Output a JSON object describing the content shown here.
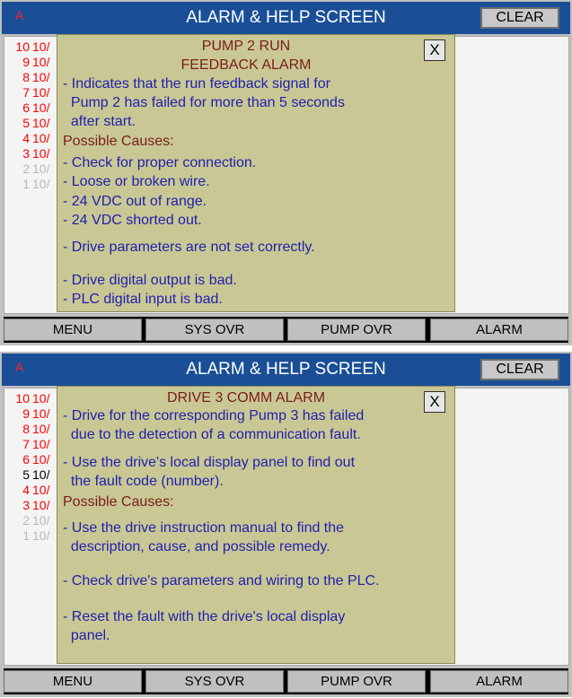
{
  "screens": [
    {
      "header": {
        "indicator": "A",
        "title": "ALARM & HELP SCREEN",
        "clear_label": "CLEAR"
      },
      "alarms": [
        {
          "num": "10",
          "text": "10/",
          "color": "#ff0000"
        },
        {
          "num": "9",
          "text": "10/",
          "color": "#ff0000"
        },
        {
          "num": "8",
          "text": "10/",
          "color": "#ff0000"
        },
        {
          "num": "7",
          "text": "10/",
          "color": "#ff0000"
        },
        {
          "num": "6",
          "text": "10/",
          "color": "#ff0000"
        },
        {
          "num": "5",
          "text": "10/",
          "color": "#ff0000"
        },
        {
          "num": "4",
          "text": "10/",
          "color": "#ff0000"
        },
        {
          "num": "3",
          "text": "10/",
          "color": "#ff0000"
        },
        {
          "num": "2",
          "text": "10/",
          "color": "#b8b8b8"
        },
        {
          "num": "1",
          "text": "10/",
          "color": "#b8b8b8"
        }
      ],
      "help": {
        "title_lines": [
          "PUMP 2 RUN",
          "FEEDBACK ALARM"
        ],
        "close_label": "X",
        "lines": [
          {
            "text": "- Indicates that the run feedback signal for",
            "style": "blue"
          },
          {
            "text": "  Pump 2 has failed for more than 5 seconds",
            "style": "blue"
          },
          {
            "text": "  after start.",
            "style": "blue"
          },
          {
            "text": "Possible Causes:",
            "style": "red"
          },
          {
            "text": "- Check for proper connection.",
            "style": "blue"
          },
          {
            "text": "- Loose or broken wire.",
            "style": "blue"
          },
          {
            "text": "- 24 VDC out of range.",
            "style": "blue"
          },
          {
            "text": "- 24 VDC shorted out.",
            "style": "blue"
          },
          {
            "text": "- Drive parameters are not set correctly.",
            "style": "blue"
          },
          {
            "text": "- Drive digital output is bad.",
            "style": "blue"
          },
          {
            "text": "- PLC digital input is bad.",
            "style": "blue"
          }
        ]
      },
      "nav": [
        "MENU",
        "SYS OVR",
        "PUMP OVR",
        "ALARM"
      ]
    },
    {
      "header": {
        "indicator": "A",
        "title": "ALARM & HELP SCREEN",
        "clear_label": "CLEAR"
      },
      "alarms": [
        {
          "num": "10",
          "text": "10/",
          "color": "#ff0000"
        },
        {
          "num": "9",
          "text": "10/",
          "color": "#ff0000"
        },
        {
          "num": "8",
          "text": "10/",
          "color": "#ff0000"
        },
        {
          "num": "7",
          "text": "10/",
          "color": "#ff0000"
        },
        {
          "num": "6",
          "text": "10/",
          "color": "#ff0000"
        },
        {
          "num": "5",
          "text": "10/",
          "color": "#000000"
        },
        {
          "num": "4",
          "text": "10/",
          "color": "#ff0000"
        },
        {
          "num": "3",
          "text": "10/",
          "color": "#ff0000"
        },
        {
          "num": "2",
          "text": "10/",
          "color": "#b8b8b8"
        },
        {
          "num": "1",
          "text": "10/",
          "color": "#b8b8b8"
        }
      ],
      "help": {
        "title_lines": [
          "DRIVE 3 COMM ALARM"
        ],
        "close_label": "X",
        "lines": [
          {
            "text": "- Drive for the corresponding Pump 3 has failed",
            "style": "blue"
          },
          {
            "text": "  due to the detection of a communication fault.",
            "style": "blue"
          },
          {
            "text": "- Use the drive's local display panel to find out",
            "style": "blue"
          },
          {
            "text": "  the fault code (number).",
            "style": "blue"
          },
          {
            "text": "Possible Causes:",
            "style": "red"
          },
          {
            "text": "- Use the drive instruction manual to find the",
            "style": "blue"
          },
          {
            "text": "  description, cause, and possible remedy.",
            "style": "blue"
          },
          {
            "text": "- Check drive's parameters and wiring to the PLC.",
            "style": "blue"
          },
          {
            "text": "- Reset the fault with the drive's local display",
            "style": "blue"
          },
          {
            "text": "  panel.",
            "style": "blue"
          }
        ]
      },
      "nav": [
        "MENU",
        "SYS OVR",
        "PUMP OVR",
        "ALARM"
      ]
    }
  ]
}
